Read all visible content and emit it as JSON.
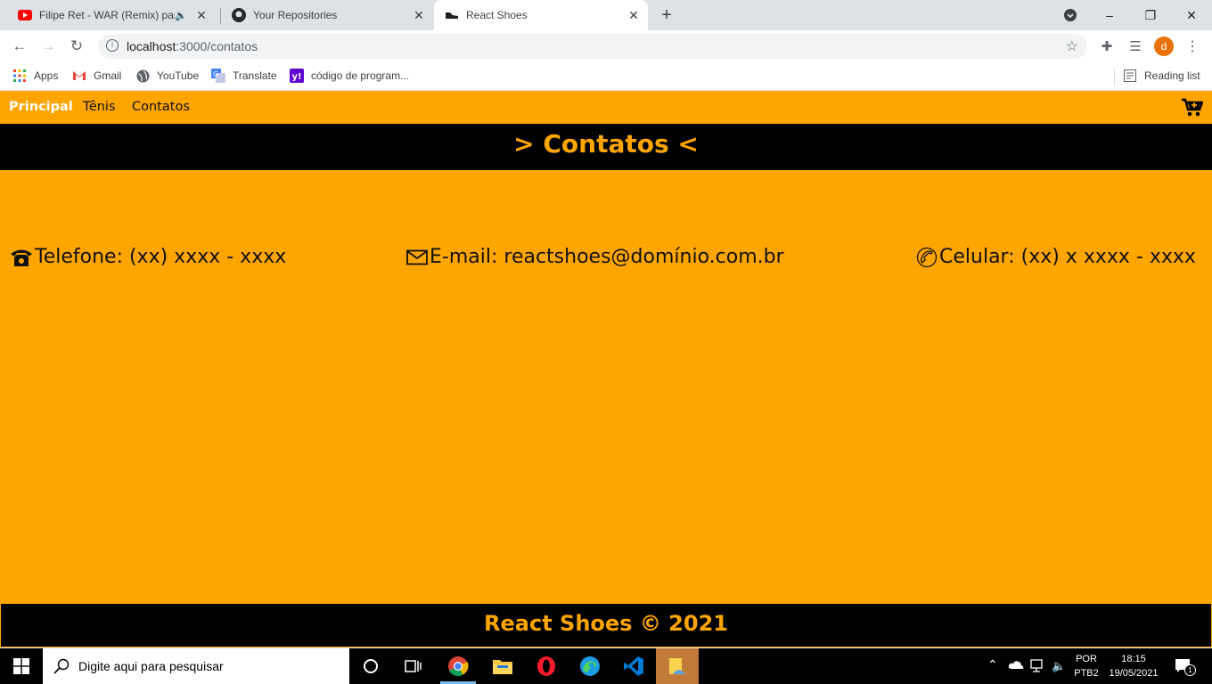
{
  "browser": {
    "tabs": [
      {
        "title": "Filipe Ret - WAR (Remix) part",
        "icon": "youtube-icon",
        "audio": true,
        "active": false
      },
      {
        "title": "Your Repositories",
        "icon": "github-icon",
        "active": false
      },
      {
        "title": "React Shoes",
        "icon": "shoe-icon",
        "active": true
      }
    ],
    "new_tab": "+",
    "url_host": "localhost",
    "url_path": ":3000/contatos",
    "profile_initial": "d",
    "bookmarks": [
      {
        "label": "Apps",
        "icon": "apps-grid-icon"
      },
      {
        "label": "Gmail",
        "icon": "gmail-icon"
      },
      {
        "label": "YouTube",
        "icon": "globe-icon"
      },
      {
        "label": "Translate",
        "icon": "translate-icon"
      },
      {
        "label": "código de program...",
        "icon": "yahoo-icon"
      }
    ],
    "reading_list": "Reading list"
  },
  "site": {
    "nav": [
      {
        "label": "Principal",
        "active": true
      },
      {
        "label": "Tênis",
        "active": false
      },
      {
        "label": "Contatos",
        "active": false
      }
    ],
    "heading": "> Contatos <",
    "contacts": [
      {
        "icon": "telephone-icon",
        "text": "Telefone: (xx) xxxx - xxxx"
      },
      {
        "icon": "envelope-icon",
        "text": "E-mail: reactshoes@domínio.com.br"
      },
      {
        "icon": "phone-handset-icon",
        "text": "Celular: (xx) x xxxx - xxxx"
      }
    ],
    "footer": "React Shoes © 2021"
  },
  "taskbar": {
    "search_placeholder": "Digite aqui para pesquisar",
    "lang_top": "POR",
    "lang_bottom": "PTB2",
    "time": "18:15",
    "date": "19/05/2021",
    "notification_count": "1"
  },
  "colors": {
    "site_accent": "#ffa500",
    "site_dark": "#000000",
    "chrome_frame": "#dee1e6"
  }
}
